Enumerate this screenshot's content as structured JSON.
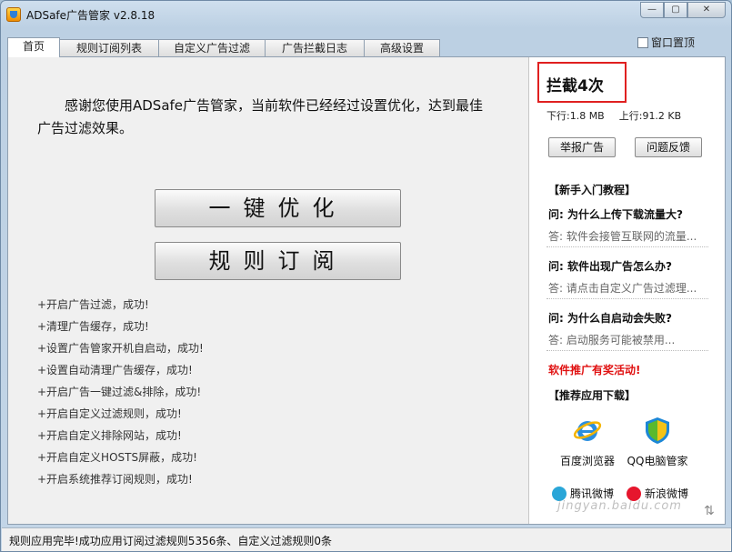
{
  "window": {
    "title": "ADSafe广告管家 v2.8.18",
    "minimize": "—",
    "maximize": "▢",
    "close": "✕"
  },
  "tabs": [
    {
      "label": "首页",
      "active": true
    },
    {
      "label": "规则订阅列表",
      "active": false
    },
    {
      "label": "自定义广告过滤",
      "active": false
    },
    {
      "label": "广告拦截日志",
      "active": false
    },
    {
      "label": "高级设置",
      "active": false
    }
  ],
  "topmost_label": "窗口置顶",
  "main": {
    "welcome": "感谢您使用ADSafe广告管家，当前软件已经经过设置优化，达到最佳广告过滤效果。",
    "optimize_button": "一键优化",
    "rules_button": "规则订阅",
    "log": [
      "+开启广告过滤，成功!",
      "+清理广告缓存，成功!",
      "+设置广告管家开机自启动，成功!",
      "+设置自动清理广告缓存，成功!",
      "+开启广告一键过滤&排除，成功!",
      "+开启自定义过滤规则，成功!",
      "+开启自定义排除网站，成功!",
      "+开启自定义HOSTS屏蔽，成功!",
      "+开启系统推荐订阅规则，成功!"
    ]
  },
  "sidebar": {
    "block_count": "拦截4次",
    "download": "下行:1.8 MB",
    "upload": "上行:91.2 KB",
    "report_button": "举报广告",
    "feedback_button": "问题反馈",
    "tutorial_head": "【新手入门教程】",
    "faq": [
      {
        "q": "问: 为什么上传下载流量大?",
        "a": "答: 软件会接管互联网的流量..."
      },
      {
        "q": "问: 软件出现广告怎么办?",
        "a": "答: 请点击自定义广告过滤理..."
      },
      {
        "q": "问: 为什么自启动会失败?",
        "a": "答: 启动服务可能被禁用..."
      }
    ],
    "promo": "软件推广有奖活动!",
    "apps_head": "【推荐应用下载】",
    "apps": [
      {
        "label": "百度浏览器",
        "icon": "ie-browser-icon"
      },
      {
        "label": "QQ电脑管家",
        "icon": "qq-pc-manager-icon"
      }
    ],
    "mini_apps": [
      {
        "label": "腾讯微博",
        "icon": "tencent-weibo-icon"
      },
      {
        "label": "新浪微博",
        "icon": "sina-weibo-icon"
      }
    ]
  },
  "status": {
    "text": "规则应用完毕!成功应用订阅过滤规则5356条、自定义过滤规则0条"
  },
  "watermark": "jingyan.baidu.com",
  "colors": {
    "highlight_border": "#e02020",
    "promo_text": "#e01010"
  }
}
